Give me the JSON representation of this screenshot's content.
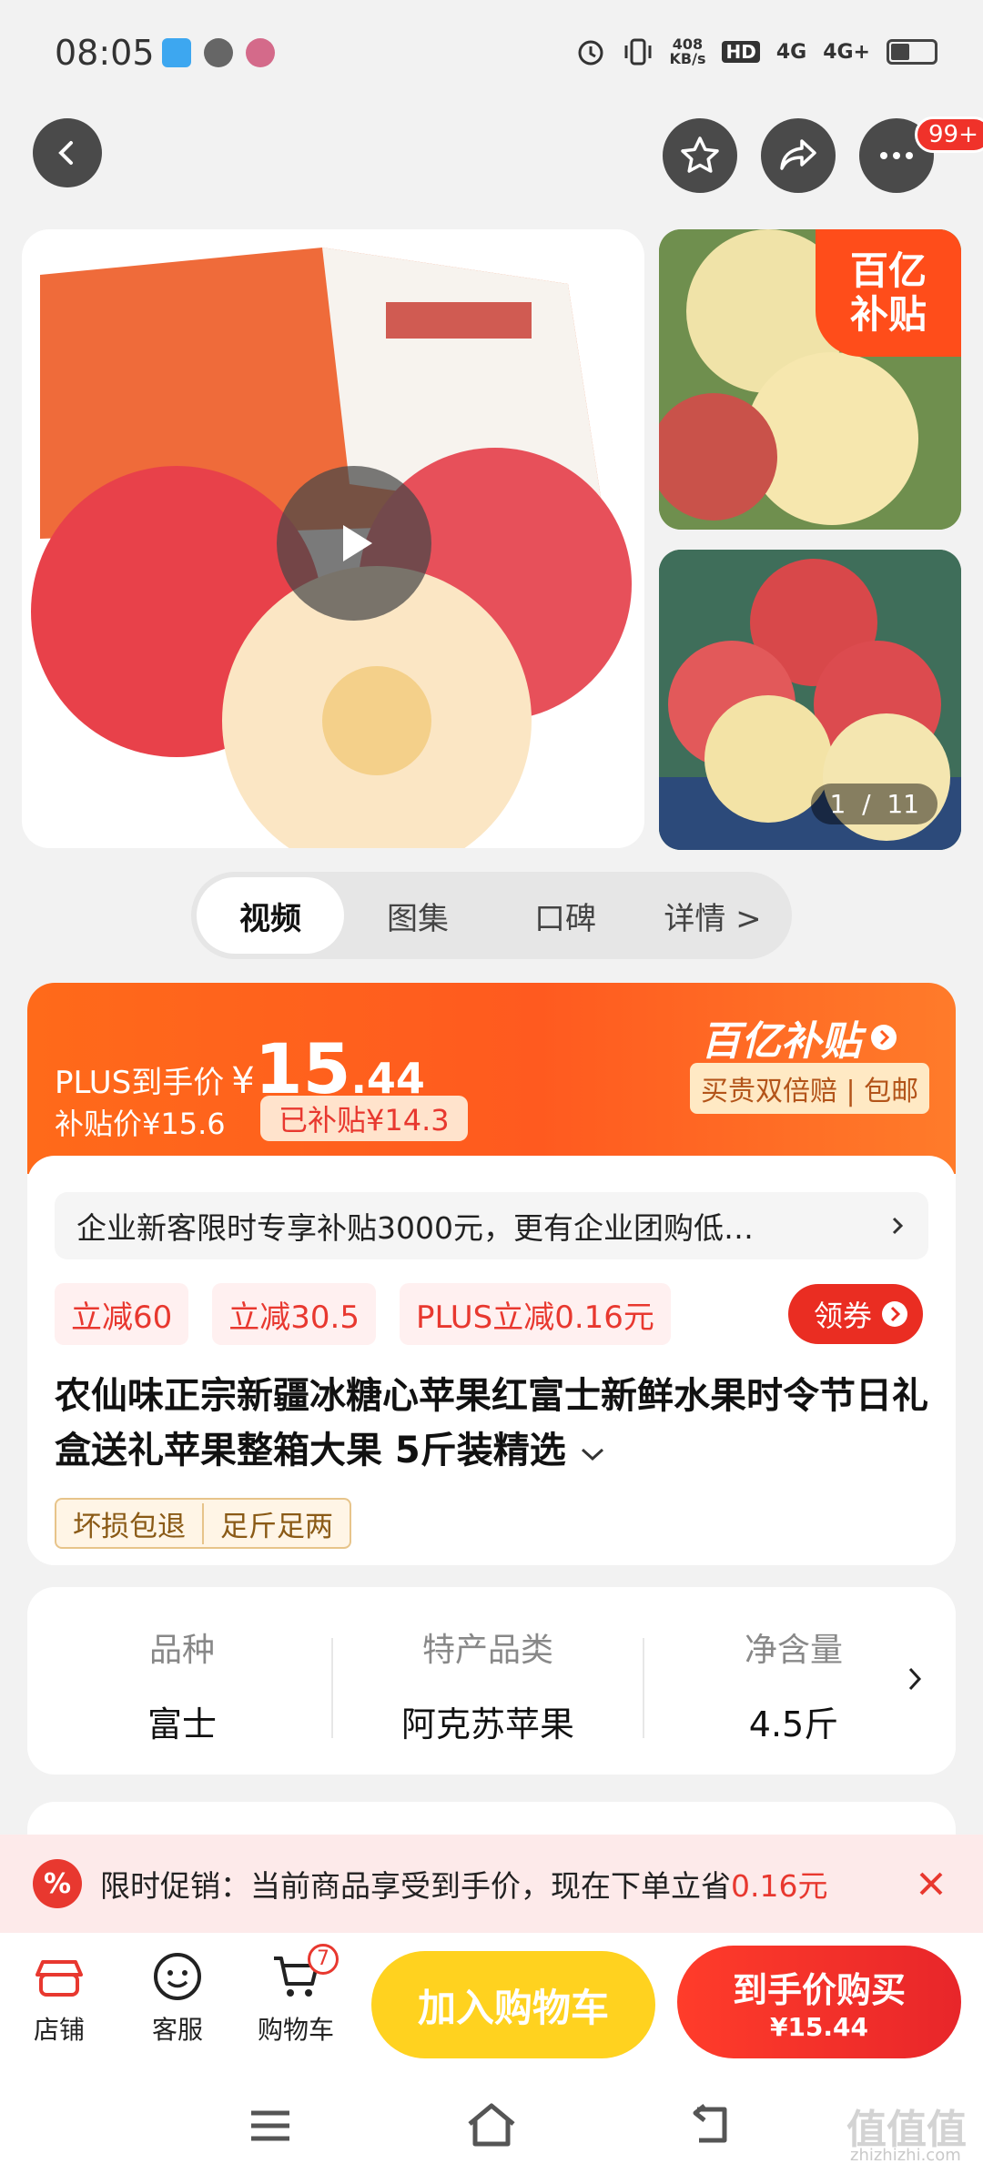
{
  "status_bar": {
    "time": "08:05",
    "net_speed": "408",
    "net_unit": "KB/s",
    "hd": "HD",
    "sig1": "4G",
    "sig2": "4G+"
  },
  "header": {
    "more_badge": "99+"
  },
  "gallery": {
    "subsidy_tag": [
      "百亿",
      "补贴"
    ],
    "counter_current": "1",
    "counter_total": "11"
  },
  "tabs": [
    {
      "label": "视频",
      "active": true
    },
    {
      "label": "图集"
    },
    {
      "label": "口碑"
    },
    {
      "label": "详情 >"
    }
  ],
  "price": {
    "plus_label": "PLUS到手价",
    "currency": "¥",
    "integer": "15",
    "decimal": ".44",
    "subsidy_price": "补贴价¥15.6",
    "subsidized": "已补贴¥14.3",
    "brand": "百亿补贴",
    "guarantee": "买贵双倍赔 | 包邮"
  },
  "notice": "企业新客限时专享补贴3000元，更有企业团购低…",
  "discounts": [
    "立减60",
    "立减30.5",
    "PLUS立减0.16元"
  ],
  "coupon_label": "领券",
  "product_title": "农仙味正宗新疆冰糖心苹果红富士新鲜水果时令节日礼盒送礼苹果整箱大果 5斤装精选",
  "service_tags": [
    "坏损包退",
    "足斤足两"
  ],
  "attributes": [
    {
      "k": "品种",
      "v": "富士"
    },
    {
      "k": "特产品类",
      "v": "阿克苏苹果"
    },
    {
      "k": "净含量",
      "v": "4.5斤"
    }
  ],
  "promo": {
    "text": "限时促销：当前商品享受到手价，现在下单立省",
    "amount": "0.16元"
  },
  "bottom": {
    "shop": "店铺",
    "service": "客服",
    "cart": "购物车",
    "cart_count": "7",
    "add_cart": "加入购物车",
    "buy_title": "到手价购买",
    "buy_price": "¥15.44"
  },
  "watermark": "zhizhizhi.com",
  "colors": {
    "accent": "#ff5a1f",
    "red": "#ea2d22",
    "yellow": "#ffd21f"
  }
}
